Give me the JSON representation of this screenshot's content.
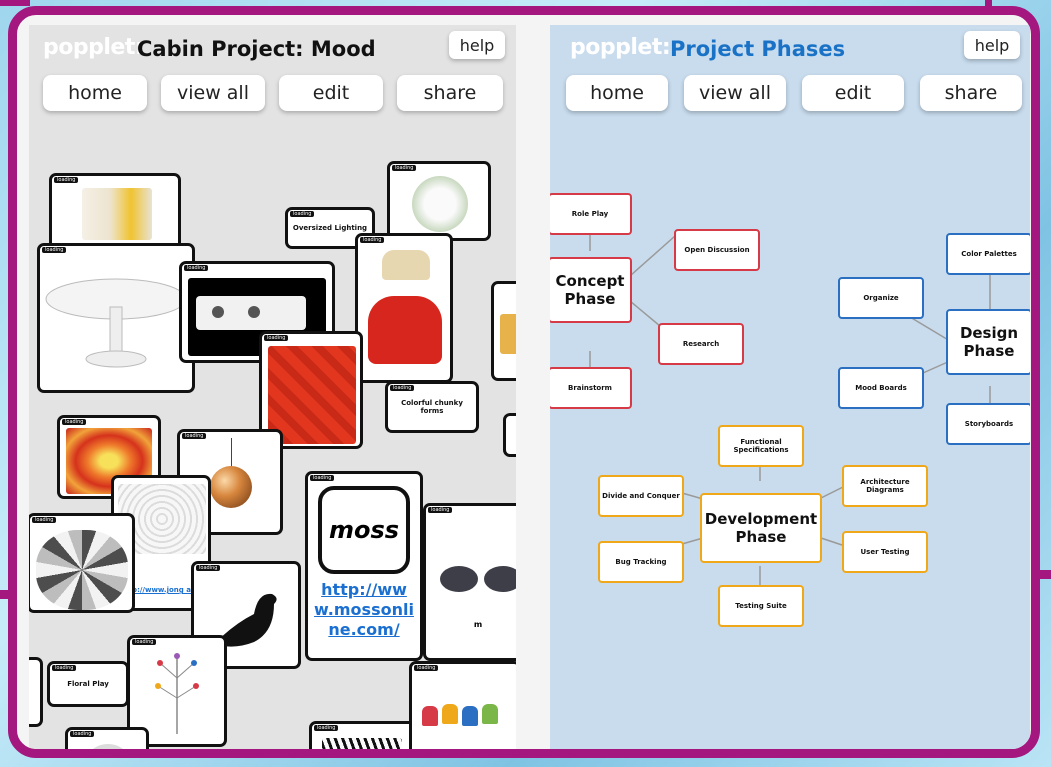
{
  "left_panel": {
    "logo": "popplet:",
    "title": "Cabin Project: Mood",
    "buttons": {
      "help": "help",
      "home": "home",
      "view_all": "view all",
      "edit": "edit",
      "share": "share"
    },
    "popplets": {
      "loading_tag": "loading",
      "oversized_lighting": "Oversized Lighting",
      "colorful_chunky": "Colorful chunky forms",
      "floral_play": "Floral Play",
      "moss_logo": "moss",
      "moss_link": "http://www.mossonline.com/",
      "partial_link": "ttp://www.jong ab.",
      "m_label": "m"
    }
  },
  "right_panel": {
    "logo": "popplet:",
    "title": "Project Phases",
    "buttons": {
      "help": "help",
      "home": "home",
      "view_all": "view all",
      "edit": "edit",
      "share": "share"
    },
    "mindmap": {
      "concept": "Concept Phase",
      "role_play": "Role Play",
      "open_discussion": "Open Discussion",
      "research": "Research",
      "brainstorm": "Brainstorm",
      "design": "Design Phase",
      "color_palettes": "Color Palettes",
      "organize": "Organize",
      "mood_boards": "Mood Boards",
      "storyboards": "Storyboards",
      "development": "Development Phase",
      "functional_specs": "Functional Specifications",
      "architecture": "Architecture Diagrams",
      "divide": "Divide and Conquer",
      "bug_tracking": "Bug Tracking",
      "user_testing": "User Testing",
      "testing_suite": "Testing Suite"
    }
  },
  "colors": {
    "frame": "#a3177f",
    "concept": "#d63a46",
    "design": "#2a6fc2",
    "development": "#f0a81b",
    "title_blue": "#1a72c6"
  }
}
